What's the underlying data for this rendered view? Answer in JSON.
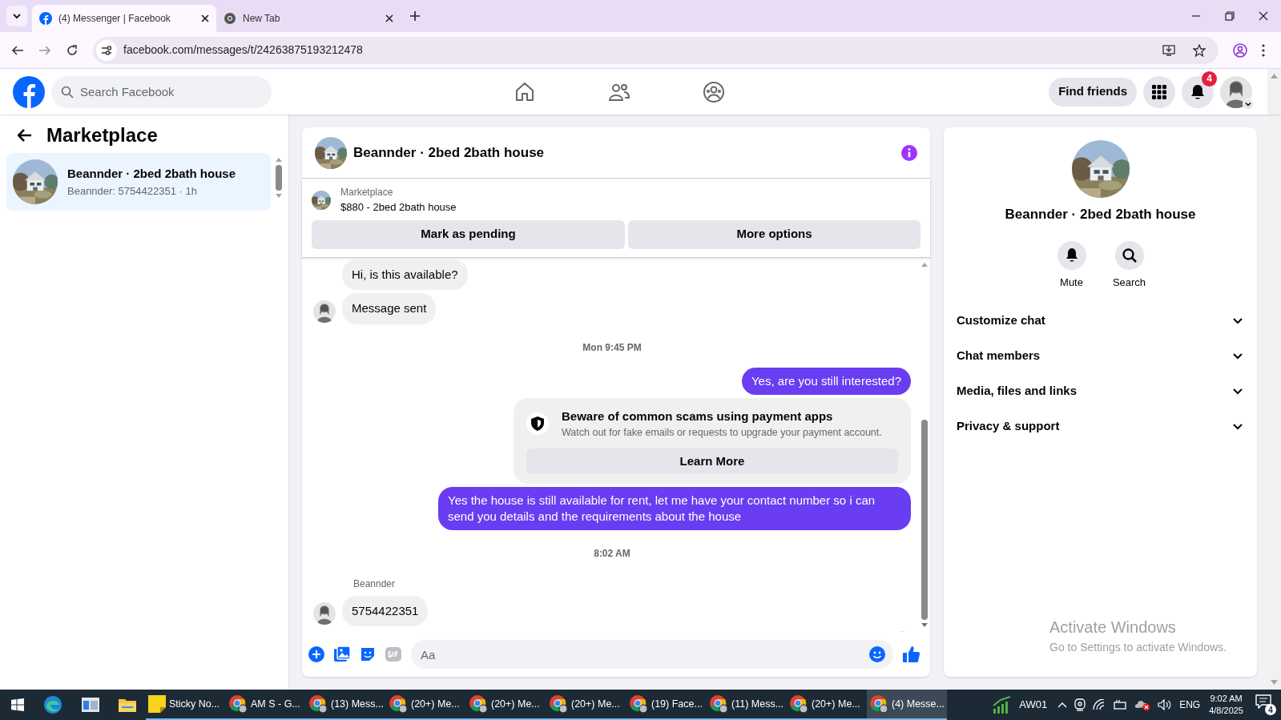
{
  "browser": {
    "tabs": [
      {
        "title": "(4) Messenger | Facebook",
        "selected": true
      },
      {
        "title": "New Tab",
        "selected": false
      }
    ],
    "url": "facebook.com/messages/t/24263875193212478"
  },
  "header": {
    "search_placeholder": "Search Facebook",
    "find_friends": "Find friends",
    "notification_count": "4"
  },
  "sidebar": {
    "title": "Marketplace",
    "conversations": [
      {
        "title": "Beannder · 2bed 2bath house",
        "subtitle": "Beannder: 5754422351 · 1h",
        "selected": true
      }
    ]
  },
  "chat": {
    "title": "Beannder · 2bed 2bath house",
    "listing": {
      "label": "Marketplace",
      "item": "$880 - 2bed 2bath house"
    },
    "actions": [
      "Mark as pending",
      "More options"
    ],
    "messages": [
      {
        "kind": "incoming",
        "text": "Hi, is this available?",
        "avatar": false
      },
      {
        "kind": "incoming",
        "text": "Message sent",
        "avatar": true
      },
      {
        "kind": "time",
        "text": "Mon 9:45 PM"
      },
      {
        "kind": "outgoing",
        "text": "Yes, are you still interested?"
      },
      {
        "kind": "notice",
        "title": "Beware of common scams using payment apps",
        "text": "Watch out for fake emails or requests to upgrade your payment account.",
        "button": "Learn More"
      },
      {
        "kind": "outgoing",
        "text": "Yes the house is still available for rent, let me have your contact number so i can send you details and the requirements about the house"
      },
      {
        "kind": "time",
        "text": "8:02 AM"
      },
      {
        "kind": "sender",
        "text": "Beannder"
      },
      {
        "kind": "incoming",
        "text": "5754422351",
        "avatar": true
      }
    ],
    "composer_placeholder": "Aa"
  },
  "details": {
    "name": "Beannder · 2bed 2bath house",
    "actions": [
      {
        "kind": "mute",
        "label": "Mute"
      },
      {
        "kind": "search",
        "label": "Search"
      }
    ],
    "sections": [
      {
        "label": "Customize chat",
        "expanded": false
      },
      {
        "label": "Chat members",
        "expanded": false
      },
      {
        "label": "Media, files and links",
        "expanded": false
      },
      {
        "label": "Privacy & support",
        "expanded": false
      }
    ]
  },
  "activation": {
    "title": "Activate Windows",
    "text": "Go to Settings to activate Windows."
  },
  "taskbar": {
    "apps": [
      {
        "kind": "notes",
        "label": "Sticky No...",
        "selected": false
      },
      {
        "kind": "chrome",
        "label": "AM S - G...",
        "selected": false
      },
      {
        "kind": "chrome",
        "label": "(13) Mess...",
        "selected": false
      },
      {
        "kind": "chrome",
        "label": "(20+) Me...",
        "selected": false
      },
      {
        "kind": "chrome",
        "label": "(20+) Me...",
        "selected": false
      },
      {
        "kind": "chrome",
        "label": "(20+) Me...",
        "selected": false
      },
      {
        "kind": "chrome",
        "label": "(19) Face...",
        "selected": false
      },
      {
        "kind": "chrome",
        "label": "(11) Mess...",
        "selected": false
      },
      {
        "kind": "chrome",
        "label": "(20+) Me...",
        "selected": false
      },
      {
        "kind": "chrome",
        "label": "(4) Messe...",
        "selected": true
      }
    ],
    "stock": "AW01",
    "language": "ENG",
    "time": "9:02 AM",
    "date": "4/8/2025",
    "notification_count": "4"
  }
}
